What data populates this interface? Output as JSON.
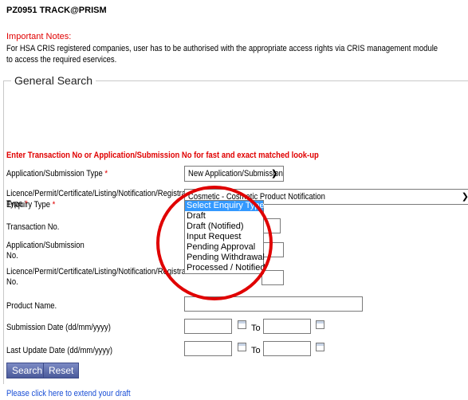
{
  "header": {
    "title": "PZ0951 TRACK@PRISM"
  },
  "notes": {
    "heading": "Important Notes:",
    "line1": "For HSA CRIS registered companies, user has to be authorised with the appropriate access rights via CRIS management module",
    "line2": "to access the required eservices."
  },
  "section": {
    "legend": "General Search"
  },
  "instruction": "Enter Transaction No or Application/Submission No for fast and exact matched look-up",
  "required_mark": "*",
  "form": {
    "application_type": {
      "label": "Application/Submission Type",
      "value": "New Application/Submission"
    },
    "licence_type": {
      "label_line1": "Licence/Permit/Certificate/Listing/Notification/Registration",
      "label_line2": "Type",
      "value": "Cosmetic - Cosmetic Product Notification"
    },
    "enquiry_type": {
      "label": "Enquiry Type"
    },
    "transaction_no": {
      "label": "Transaction No."
    },
    "application_no": {
      "label_line1": "Application/Submission",
      "label_line2": "No."
    },
    "licence_no": {
      "label_line1": "Licence/Permit/Certificate/Listing/Notification/Registration",
      "label_line2": "No."
    },
    "product_name": {
      "label": "Product Name."
    },
    "submission_date": {
      "label": "Submission Date (dd/mm/yyyy)",
      "to": "To"
    },
    "last_update_date": {
      "label": "Last Update Date (dd/mm/yyyy)",
      "to": "To"
    }
  },
  "enquiry_options": [
    "Select Enquiry Type",
    "Draft",
    "Draft (Notified)",
    "Input Request",
    "Pending Approval",
    "Pending Withdrawal",
    "Processed / Notified"
  ],
  "buttons": {
    "search": "Search",
    "reset": "Reset"
  },
  "footer": {
    "extend_link": "Please click here to extend your draft"
  },
  "colors": {
    "accent_red": "#e00000",
    "link_blue": "#1a4fd6",
    "button_blue": "#5a6aac",
    "highlight": "#3399ff"
  },
  "icons": {
    "calendar": "calendar-icon",
    "dropdown": "chevron-down-icon"
  }
}
